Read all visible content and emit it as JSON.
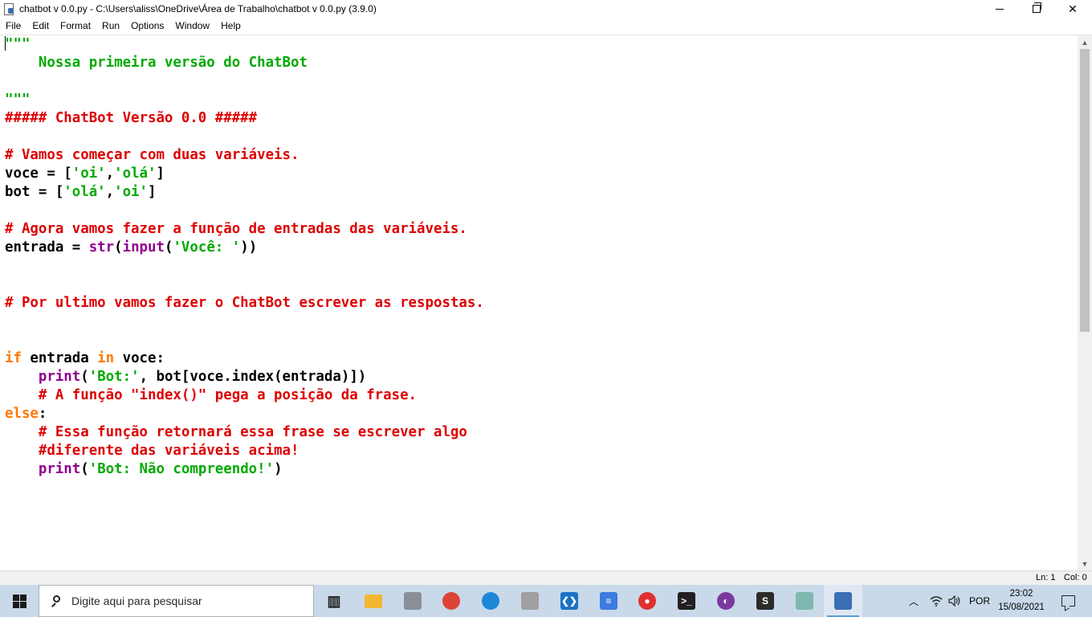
{
  "window": {
    "title": "chatbot v 0.0.py - C:\\Users\\aliss\\OneDrive\\Área de Trabalho\\chatbot v 0.0.py (3.9.0)",
    "minimize_label": "minimize",
    "maximize_label": "restore",
    "close_label": "✕"
  },
  "menu": [
    "File",
    "Edit",
    "Format",
    "Run",
    "Options",
    "Window",
    "Help"
  ],
  "code_lines": [
    [
      {
        "t": "\"\"\"",
        "c": "str"
      }
    ],
    [
      {
        "t": "    Nossa primeira versão do ChatBot",
        "c": "str"
      }
    ],
    [],
    [
      {
        "t": "\"\"\"",
        "c": "str"
      }
    ],
    [
      {
        "t": "##### ChatBot Versão 0.0 #####",
        "c": "cmt"
      }
    ],
    [],
    [
      {
        "t": "# Vamos começar com duas variáveis.",
        "c": "cmt"
      }
    ],
    [
      {
        "t": "voce = [",
        "c": ""
      },
      {
        "t": "'oi'",
        "c": "str"
      },
      {
        "t": ",",
        "c": ""
      },
      {
        "t": "'olá'",
        "c": "str"
      },
      {
        "t": "]",
        "c": ""
      }
    ],
    [
      {
        "t": "bot = [",
        "c": ""
      },
      {
        "t": "'olá'",
        "c": "str"
      },
      {
        "t": ",",
        "c": ""
      },
      {
        "t": "'oi'",
        "c": "str"
      },
      {
        "t": "]",
        "c": ""
      }
    ],
    [],
    [
      {
        "t": "# Agora vamos fazer a função de entradas das variáveis.",
        "c": "cmt"
      }
    ],
    [
      {
        "t": "entrada = ",
        "c": ""
      },
      {
        "t": "str",
        "c": "bi"
      },
      {
        "t": "(",
        "c": ""
      },
      {
        "t": "input",
        "c": "bi"
      },
      {
        "t": "(",
        "c": ""
      },
      {
        "t": "'Você: '",
        "c": "str"
      },
      {
        "t": "))",
        "c": ""
      }
    ],
    [],
    [],
    [
      {
        "t": "# Por ultimo vamos fazer o ChatBot escrever as respostas.",
        "c": "cmt"
      }
    ],
    [],
    [],
    [
      {
        "t": "if",
        "c": "kw"
      },
      {
        "t": " entrada ",
        "c": ""
      },
      {
        "t": "in",
        "c": "kw"
      },
      {
        "t": " voce:",
        "c": ""
      }
    ],
    [
      {
        "t": "    ",
        "c": ""
      },
      {
        "t": "print",
        "c": "bi"
      },
      {
        "t": "(",
        "c": ""
      },
      {
        "t": "'Bot:'",
        "c": "str"
      },
      {
        "t": ", bot[voce.index(entrada)])",
        "c": ""
      }
    ],
    [
      {
        "t": "    # A função \"index()\" pega a posição da frase.",
        "c": "cmt"
      }
    ],
    [
      {
        "t": "else",
        "c": "kw"
      },
      {
        "t": ":",
        "c": ""
      }
    ],
    [
      {
        "t": "    # Essa função retornará essa frase se escrever algo",
        "c": "cmt"
      }
    ],
    [
      {
        "t": "    #diferente das variáveis acima!",
        "c": "cmt"
      }
    ],
    [
      {
        "t": "    ",
        "c": ""
      },
      {
        "t": "print",
        "c": "bi"
      },
      {
        "t": "(",
        "c": ""
      },
      {
        "t": "'Bot: Não compreendo!'",
        "c": "str"
      },
      {
        "t": ")",
        "c": ""
      }
    ]
  ],
  "status": {
    "line": "Ln: 1",
    "col": "Col: 0"
  },
  "taskbar": {
    "search_placeholder": "Digite aqui para pesquisar",
    "apps": [
      {
        "name": "task-view",
        "color": "#1a1a1a"
      },
      {
        "name": "file-explorer",
        "color": "#f2b632"
      },
      {
        "name": "photos",
        "color": "#8a8f99"
      },
      {
        "name": "chrome",
        "color": "#db4437"
      },
      {
        "name": "edge",
        "color": "#1e88d8"
      },
      {
        "name": "notepad-app",
        "color": "#a0a0a0"
      },
      {
        "name": "vscode",
        "color": "#1a73c4"
      },
      {
        "name": "docs",
        "color": "#3d7be0"
      },
      {
        "name": "screen-recorder",
        "color": "#e03030"
      },
      {
        "name": "terminal",
        "color": "#202020"
      },
      {
        "name": "tor-browser",
        "color": "#7a3aa0"
      },
      {
        "name": "sublime",
        "color": "#2b2b2b"
      },
      {
        "name": "notepad-plus",
        "color": "#7fb8b0"
      },
      {
        "name": "python-idle",
        "color": "#3a6fb3"
      }
    ],
    "tray": {
      "language": "POR",
      "time": "23:02",
      "date": "15/08/2021"
    }
  }
}
